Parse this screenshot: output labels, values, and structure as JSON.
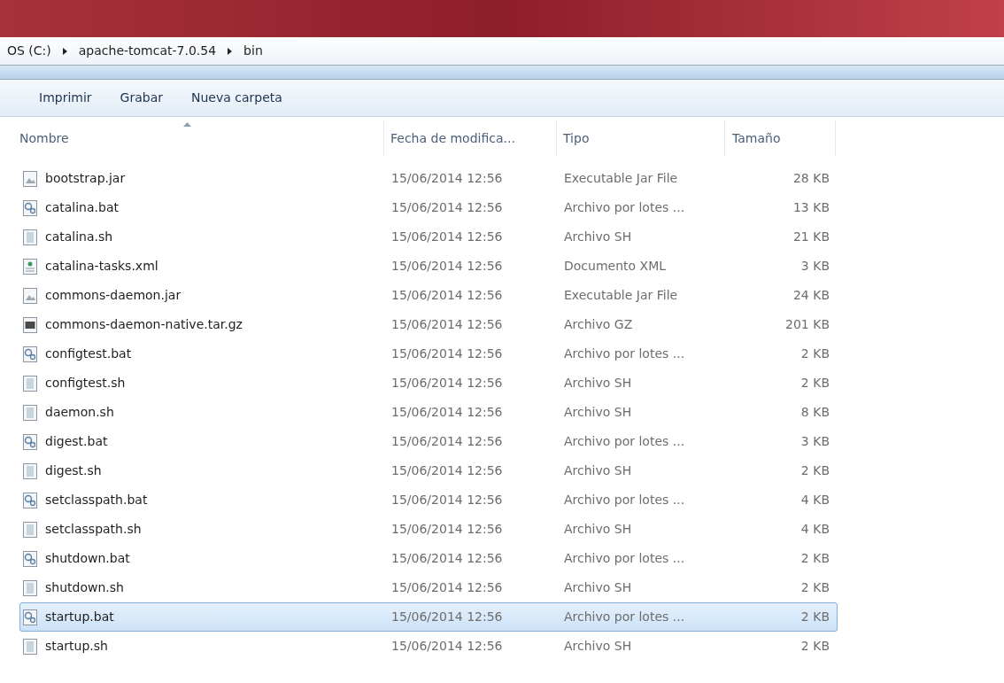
{
  "breadcrumb": [
    "OS (C:)",
    "apache-tomcat-7.0.54",
    "bin"
  ],
  "toolbar": [
    "Imprimir",
    "Grabar",
    "Nueva carpeta"
  ],
  "columns": [
    "Nombre",
    "Fecha de modifica...",
    "Tipo",
    "Tamaño"
  ],
  "rows": [
    {
      "kind": "jar",
      "name": "bootstrap.jar",
      "date": "15/06/2014 12:56",
      "type": "Executable Jar File",
      "size": "28 KB",
      "selected": false
    },
    {
      "kind": "bat",
      "name": "catalina.bat",
      "date": "15/06/2014 12:56",
      "type": "Archivo por lotes ...",
      "size": "13 KB",
      "selected": false
    },
    {
      "kind": "sh",
      "name": "catalina.sh",
      "date": "15/06/2014 12:56",
      "type": "Archivo SH",
      "size": "21 KB",
      "selected": false
    },
    {
      "kind": "xml",
      "name": "catalina-tasks.xml",
      "date": "15/06/2014 12:56",
      "type": "Documento XML",
      "size": "3 KB",
      "selected": false
    },
    {
      "kind": "jar",
      "name": "commons-daemon.jar",
      "date": "15/06/2014 12:56",
      "type": "Executable Jar File",
      "size": "24 KB",
      "selected": false
    },
    {
      "kind": "gz",
      "name": "commons-daemon-native.tar.gz",
      "date": "15/06/2014 12:56",
      "type": "Archivo GZ",
      "size": "201 KB",
      "selected": false
    },
    {
      "kind": "bat",
      "name": "configtest.bat",
      "date": "15/06/2014 12:56",
      "type": "Archivo por lotes ...",
      "size": "2 KB",
      "selected": false
    },
    {
      "kind": "sh",
      "name": "configtest.sh",
      "date": "15/06/2014 12:56",
      "type": "Archivo SH",
      "size": "2 KB",
      "selected": false
    },
    {
      "kind": "sh",
      "name": "daemon.sh",
      "date": "15/06/2014 12:56",
      "type": "Archivo SH",
      "size": "8 KB",
      "selected": false
    },
    {
      "kind": "bat",
      "name": "digest.bat",
      "date": "15/06/2014 12:56",
      "type": "Archivo por lotes ...",
      "size": "3 KB",
      "selected": false
    },
    {
      "kind": "sh",
      "name": "digest.sh",
      "date": "15/06/2014 12:56",
      "type": "Archivo SH",
      "size": "2 KB",
      "selected": false
    },
    {
      "kind": "bat",
      "name": "setclasspath.bat",
      "date": "15/06/2014 12:56",
      "type": "Archivo por lotes ...",
      "size": "4 KB",
      "selected": false
    },
    {
      "kind": "sh",
      "name": "setclasspath.sh",
      "date": "15/06/2014 12:56",
      "type": "Archivo SH",
      "size": "4 KB",
      "selected": false
    },
    {
      "kind": "bat",
      "name": "shutdown.bat",
      "date": "15/06/2014 12:56",
      "type": "Archivo por lotes ...",
      "size": "2 KB",
      "selected": false
    },
    {
      "kind": "sh",
      "name": "shutdown.sh",
      "date": "15/06/2014 12:56",
      "type": "Archivo SH",
      "size": "2 KB",
      "selected": false
    },
    {
      "kind": "bat",
      "name": "startup.bat",
      "date": "15/06/2014 12:56",
      "type": "Archivo por lotes ...",
      "size": "2 KB",
      "selected": true
    },
    {
      "kind": "sh",
      "name": "startup.sh",
      "date": "15/06/2014 12:56",
      "type": "Archivo SH",
      "size": "2 KB",
      "selected": false
    }
  ]
}
